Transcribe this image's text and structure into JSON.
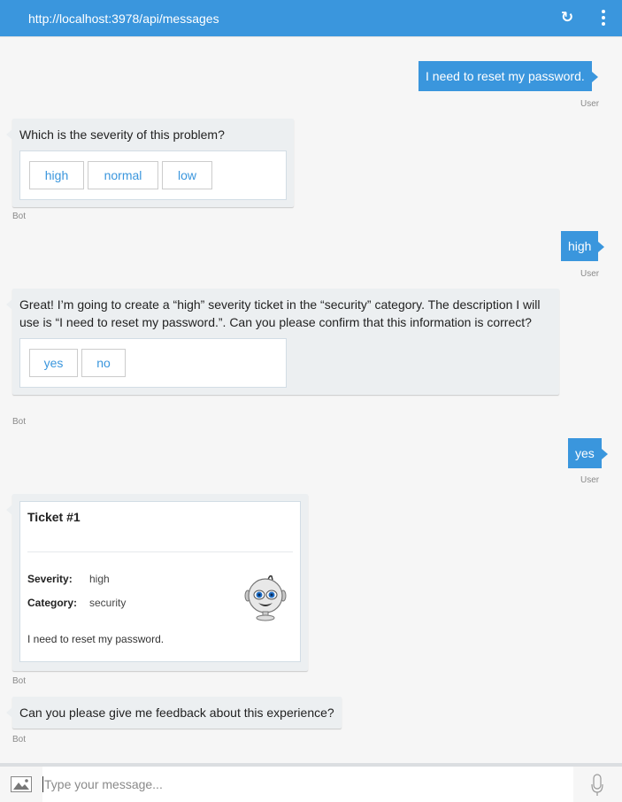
{
  "header": {
    "url": "http://localhost:3978/api/messages",
    "refresh_icon": "refresh-icon",
    "more_icon": "more-vertical-icon",
    "accent": "#3a96dd"
  },
  "messages": [
    {
      "from": "User",
      "text": "I need to reset my password."
    },
    {
      "from": "Bot",
      "text": "Which is the severity of this problem?",
      "choices": [
        "high",
        "normal",
        "low"
      ]
    },
    {
      "from": "User",
      "text": "high"
    },
    {
      "from": "Bot",
      "text": "Great! I’m going to create a “high” severity ticket in the “security” category. The description I will use is “I need to reset my password.”. Can you please confirm that this information is correct?",
      "choices": [
        "yes",
        "no"
      ]
    },
    {
      "from": "User",
      "text": "yes"
    },
    {
      "from": "Bot",
      "card": {
        "title": "Ticket #1",
        "facts": [
          {
            "label": "Severity:",
            "value": "high"
          },
          {
            "label": "Category:",
            "value": "security"
          }
        ],
        "description": "I need to reset my password.",
        "image_icon": "robot-icon"
      }
    },
    {
      "from": "Bot",
      "text": "Can you please give me feedback about this experience?"
    }
  ],
  "composer": {
    "placeholder": "Type your message...",
    "value": "",
    "upload_icon": "image-upload-icon",
    "mic_icon": "microphone-icon"
  }
}
